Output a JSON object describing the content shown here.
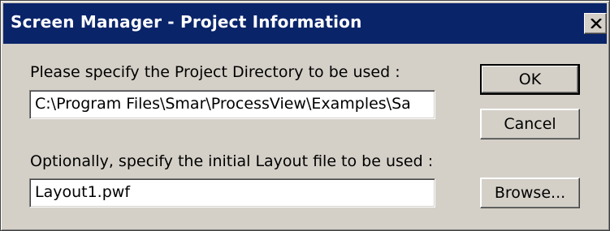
{
  "window": {
    "title": "Screen Manager - Project Information"
  },
  "icons": {
    "close": "close-icon"
  },
  "project_directory": {
    "label": "Please specify the Project Directory to be used :",
    "value": "C:\\Program Files\\Smar\\ProcessView\\Examples\\Sa"
  },
  "layout_file": {
    "label": "Optionally, specify the initial Layout file to be used :",
    "value": "Layout1.pwf"
  },
  "buttons": {
    "ok": "OK",
    "cancel": "Cancel",
    "browse": "Browse..."
  },
  "colors": {
    "titlebar": "#0a246a",
    "face": "#d4d0c8"
  }
}
